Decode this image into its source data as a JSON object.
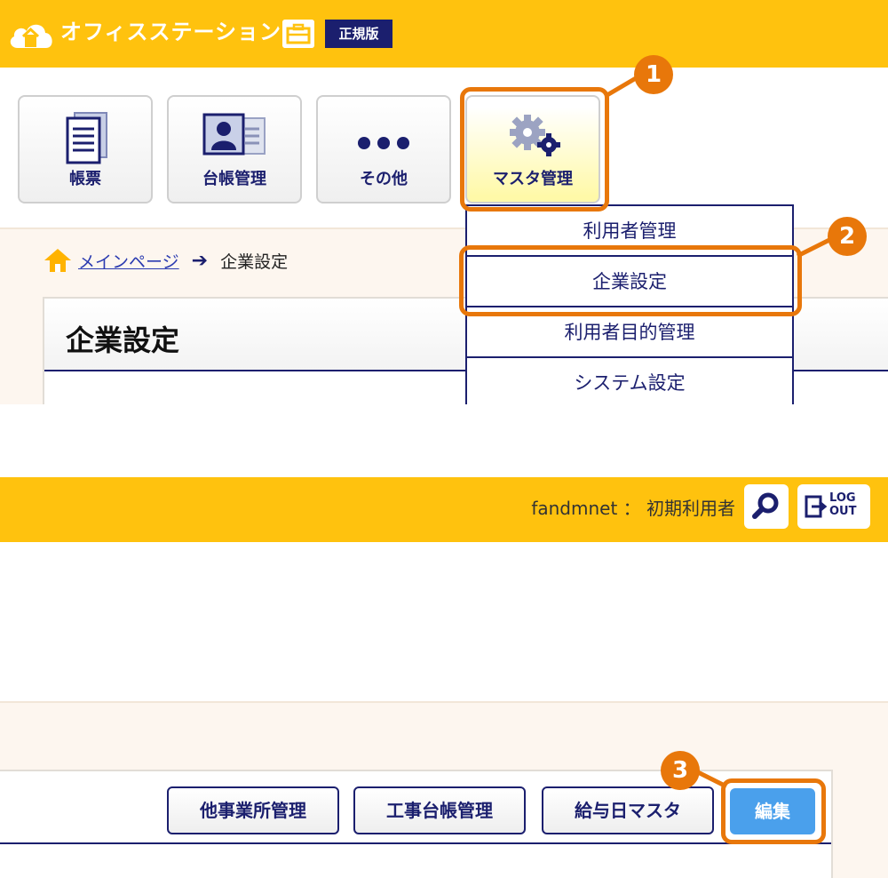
{
  "header": {
    "app_name": "オフィスステーション",
    "edition": "正規版"
  },
  "menu": [
    {
      "label": "帳票",
      "icon": "document-icon"
    },
    {
      "label": "台帳管理",
      "icon": "id-card-icon"
    },
    {
      "label": "その他",
      "icon": "more-dots-icon"
    },
    {
      "label": "マスタ管理",
      "icon": "gears-icon",
      "active": true
    }
  ],
  "breadcrumb": {
    "home": "メインページ",
    "current": "企業設定"
  },
  "page_title": "企業設定",
  "dropdown": [
    "利用者管理",
    "企業設定",
    "利用者目的管理",
    "システム設定"
  ],
  "callouts": [
    "1",
    "2",
    "3"
  ],
  "header2": {
    "user": "fandmnet ： 初期利用者",
    "logout_line1": "LOG",
    "logout_line2": "OUT"
  },
  "toolbar": {
    "buttons": [
      "他事業所管理",
      "工事台帳管理",
      "給与日マスタ"
    ],
    "edit": "編集"
  },
  "colors": {
    "header": "#ffc20e",
    "navy": "#1b1f6e",
    "callout": "#e8770a",
    "edit_button": "#4aa0ec"
  }
}
